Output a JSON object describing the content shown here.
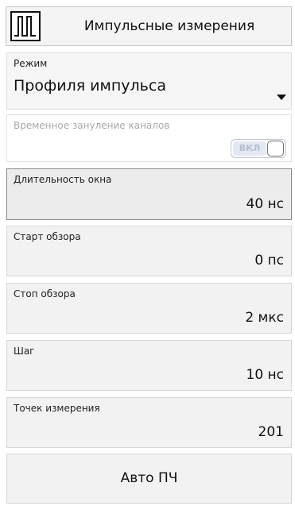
{
  "header": {
    "logo_icon": "pulse-train-icon",
    "title": "Импульсные измерения"
  },
  "mode": {
    "label": "Режим",
    "value": "Профиля импульса"
  },
  "zeroing": {
    "label": "Временное зануление каналов",
    "toggle_text": "ВКЛ",
    "toggle_on": false
  },
  "fields": {
    "window": {
      "label": "Длительность окна",
      "value": "40 нс"
    },
    "start": {
      "label": "Старт обзора",
      "value": "0 пс"
    },
    "stop": {
      "label": "Стоп обзора",
      "value": "2 мкс"
    },
    "step": {
      "label": "Шаг",
      "value": "10 нс"
    },
    "points": {
      "label": "Точек измерения",
      "value": "201"
    }
  },
  "auto_button": {
    "label": "Авто ПЧ"
  }
}
